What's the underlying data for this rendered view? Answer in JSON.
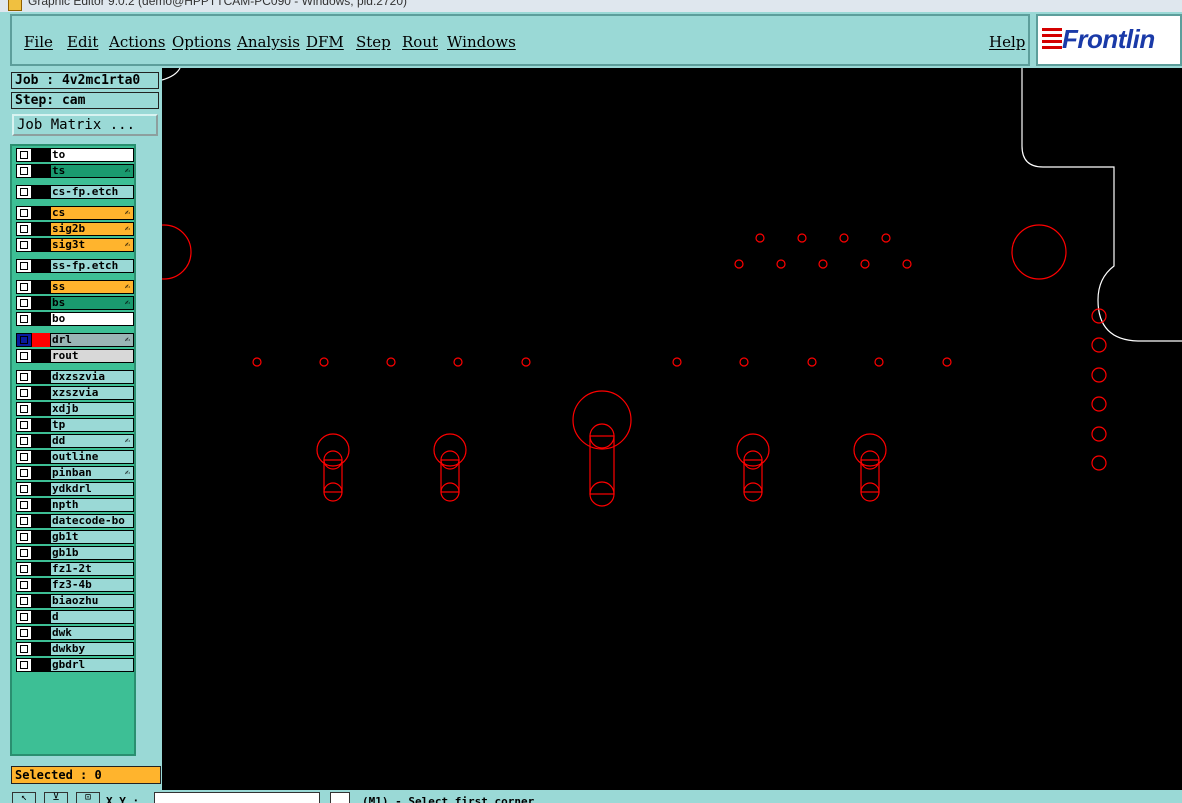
{
  "window": {
    "title": "Graphic Editor 9.0.2 (demo@HPPTTCAM-PC090 - Windows, pid:2720)"
  },
  "menu": {
    "file": "File",
    "edit": "Edit",
    "actions": "Actions",
    "options": "Options",
    "analysis": "Analysis",
    "dfm": "DFM",
    "step": "Step",
    "rout": "Rout",
    "windows": "Windows",
    "help": "Help"
  },
  "logo": {
    "text": "Frontlin"
  },
  "job": {
    "label": "Job : 4v2mc1rta0",
    "step": "Step: cam",
    "matrix_button": "Job Matrix ..."
  },
  "layers": [
    {
      "name": "to",
      "color": "#ffffff",
      "lock": false
    },
    {
      "name": "ts",
      "color": "#1a9a6f",
      "lock": true
    },
    {
      "name": "cs-fp.etch",
      "color": "#9ad9d6",
      "lock": false
    },
    {
      "name": "cs",
      "color": "#ffb42d",
      "lock": true
    },
    {
      "name": "sig2b",
      "color": "#ffb42d",
      "lock": true
    },
    {
      "name": "sig3t",
      "color": "#ffb42d",
      "lock": true
    },
    {
      "name": "ss-fp.etch",
      "color": "#9ad9d6",
      "lock": false
    },
    {
      "name": "ss",
      "color": "#ffb42d",
      "lock": true
    },
    {
      "name": "bs",
      "color": "#1a9a6f",
      "lock": true
    },
    {
      "name": "bo",
      "color": "#ffffff",
      "lock": false
    },
    {
      "name": "drl",
      "color": "#9ab5b5",
      "lock": true
    },
    {
      "name": "rout",
      "color": "#d8d8d8",
      "lock": false
    },
    {
      "name": "dxzszvia",
      "color": "#9ad9d6",
      "lock": false
    },
    {
      "name": "xzszvia",
      "color": "#9ad9d6",
      "lock": false
    },
    {
      "name": "xdjb",
      "color": "#9ad9d6",
      "lock": false
    },
    {
      "name": "tp",
      "color": "#9ad9d6",
      "lock": false
    },
    {
      "name": "dd",
      "color": "#9ad9d6",
      "lock": true
    },
    {
      "name": "outline",
      "color": "#9ad9d6",
      "lock": false
    },
    {
      "name": "pinban",
      "color": "#9ad9d6",
      "lock": true
    },
    {
      "name": "ydkdrl",
      "color": "#9ad9d6",
      "lock": false
    },
    {
      "name": "npth",
      "color": "#9ad9d6",
      "lock": false
    },
    {
      "name": "datecode-bo",
      "color": "#9ad9d6",
      "lock": false
    },
    {
      "name": "gb1t",
      "color": "#9ad9d6",
      "lock": false
    },
    {
      "name": "gb1b",
      "color": "#9ad9d6",
      "lock": false
    },
    {
      "name": "fz1-2t",
      "color": "#9ad9d6",
      "lock": false
    },
    {
      "name": "fz3-4b",
      "color": "#9ad9d6",
      "lock": false
    },
    {
      "name": "biaozhu",
      "color": "#9ad9d6",
      "lock": false
    },
    {
      "name": "d",
      "color": "#9ad9d6",
      "lock": false
    },
    {
      "name": "dwk",
      "color": "#9ad9d6",
      "lock": false
    },
    {
      "name": "dwkby",
      "color": "#9ad9d6",
      "lock": false
    },
    {
      "name": "gbdrl",
      "color": "#9ad9d6",
      "lock": false
    }
  ],
  "selected": "Selected : 0",
  "status": {
    "xy_label": "X,Y :",
    "coord_value": "",
    "message": "(M1) - Select first corner"
  },
  "colors": {
    "canvas_bg": "#000000",
    "drill_features": "#ff0000",
    "outline": "#ffffff",
    "panel": "#9ad9d6",
    "layer_panel": "#3dbf95"
  }
}
